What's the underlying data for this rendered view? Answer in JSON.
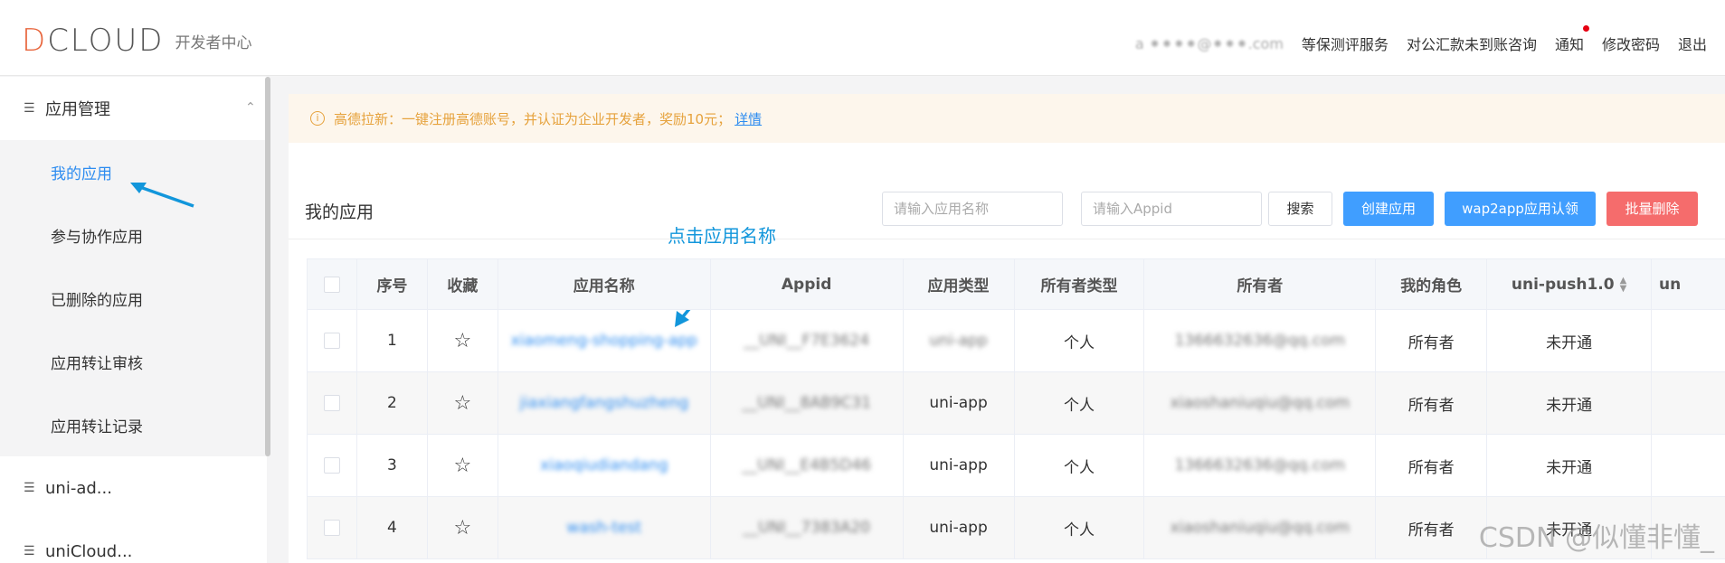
{
  "header": {
    "logo_text": "DCLOUD",
    "logo_sub": "开发者中心",
    "user": "a ⁕⁕⁕⁕@⁕⁕⁕.com",
    "nav": [
      "等保测评服务",
      "对公汇款未到账咨询",
      "通知",
      "修改密码",
      "退出"
    ]
  },
  "sidebar": {
    "groups": [
      {
        "label": "应用管理",
        "items": [
          "我的应用",
          "参与协作应用",
          "已删除的应用",
          "应用转让审核",
          "应用转让记录"
        ]
      },
      {
        "label": "uni-ad..."
      },
      {
        "label": "uniCloud..."
      }
    ]
  },
  "notice": {
    "text": "高德拉新：一键注册高德账号，并认证为企业开发者，奖励10元；",
    "link": "详情"
  },
  "panel": {
    "title": "我的应用",
    "search_name_placeholder": "请输入应用名称",
    "search_appid_placeholder": "请输入Appid",
    "search_button": "搜索",
    "create_button": "创建应用",
    "wap2app_button": "wap2app应用认领",
    "batch_delete_button": "批量删除"
  },
  "annotation": "点击应用名称",
  "table": {
    "headers": [
      "序号",
      "收藏",
      "应用名称",
      "Appid",
      "应用类型",
      "所有者类型",
      "所有者",
      "我的角色",
      "uni-push1.0",
      "un"
    ],
    "rows": [
      {
        "index": "1",
        "name": "xiaomeng-shopping-app",
        "appid": "__UNI__F7E3624",
        "type": "uni-app",
        "owner_type": "个人",
        "owner": "1366632636@qq.com",
        "role": "所有者",
        "push": "未开通"
      },
      {
        "index": "2",
        "name": "jiaxiangfangshuzheng",
        "appid": "__UNI__8AB9C31",
        "type": "uni-app",
        "owner_type": "个人",
        "owner": "xiaoshaniuqiu@qq.com",
        "role": "所有者",
        "push": "未开通"
      },
      {
        "index": "3",
        "name": "xiaoqiudiandang",
        "appid": "__UNI__E4B5D46",
        "type": "uni-app",
        "owner_type": "个人",
        "owner": "1366632636@qq.com",
        "role": "所有者",
        "push": "未开通"
      },
      {
        "index": "4",
        "name": "wash-test",
        "appid": "__UNI__7383A20",
        "type": "uni-app",
        "owner_type": "个人",
        "owner": "xiaoshaniuqiu@qq.com",
        "role": "所有者",
        "push": "未开通"
      }
    ]
  },
  "watermark": "CSDN @似懂非懂_",
  "colors": {
    "primary": "#409eff",
    "danger": "#f56c6c",
    "link": "#2d8cf0",
    "warning": "#e6a23c",
    "annotation": "#1296db"
  }
}
